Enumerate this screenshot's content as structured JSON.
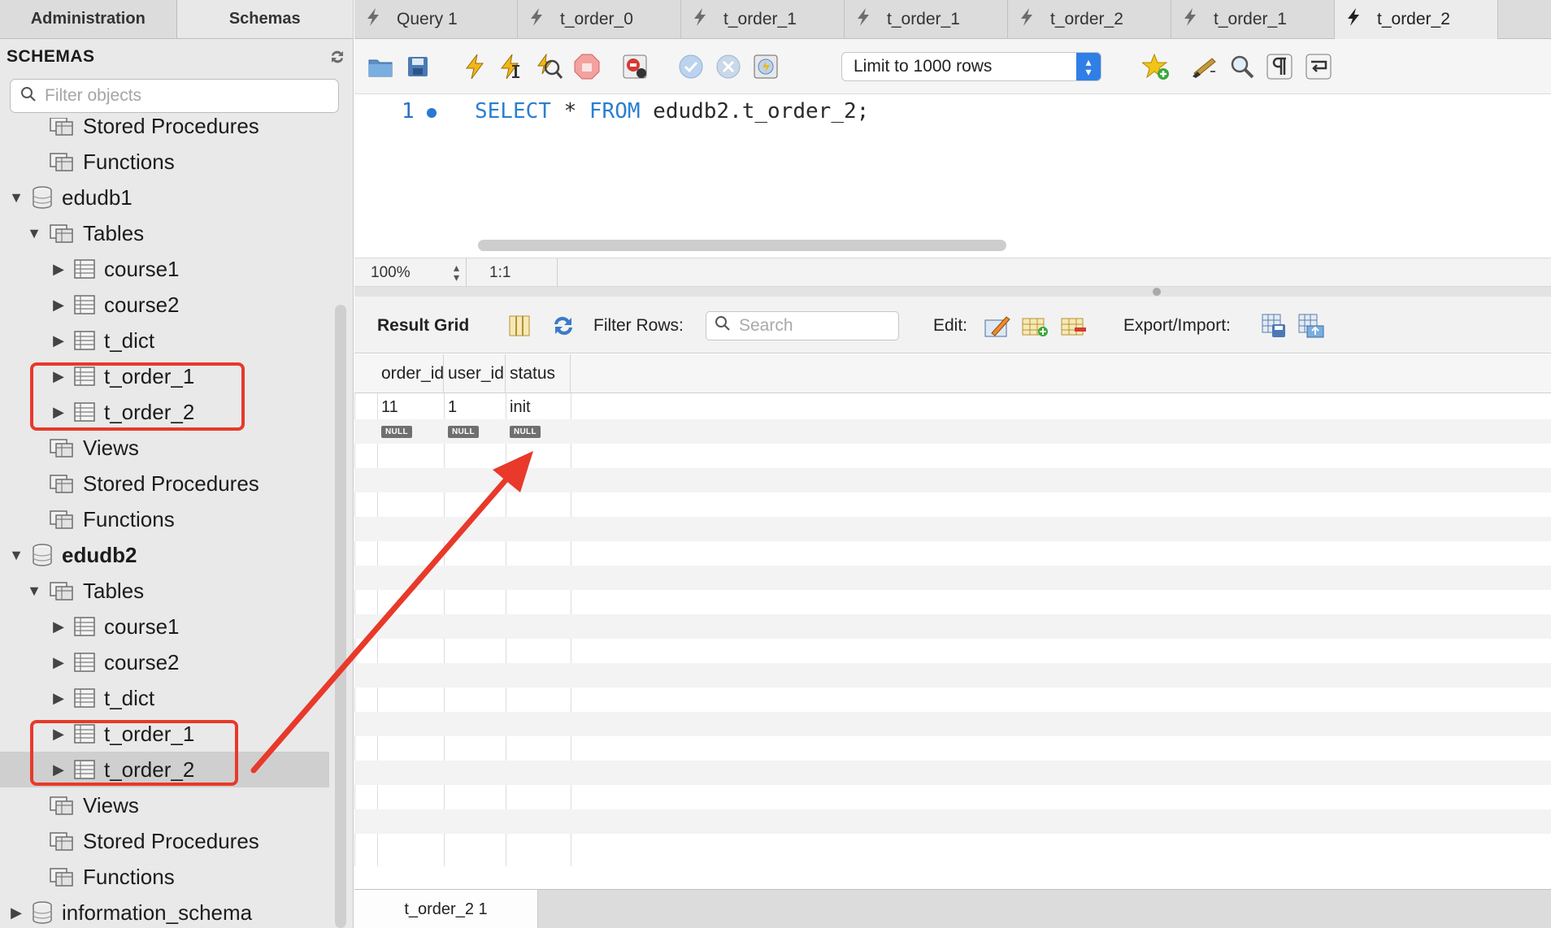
{
  "sidebar": {
    "tabs": [
      "Administration",
      "Schemas"
    ],
    "title": "SCHEMAS",
    "filter_placeholder": "Filter objects",
    "tree": [
      {
        "label": "Stored Procedures",
        "indent": 1,
        "icon": "folder-icon"
      },
      {
        "label": "Functions",
        "indent": 1,
        "icon": "folder-icon"
      },
      {
        "label": "edudb1",
        "indent": 0,
        "icon": "database-icon",
        "expanded": true
      },
      {
        "label": "Tables",
        "indent": 1,
        "icon": "folder-icon",
        "expanded": true
      },
      {
        "label": "course1",
        "indent": 2,
        "icon": "table-icon"
      },
      {
        "label": "course2",
        "indent": 2,
        "icon": "table-icon"
      },
      {
        "label": "t_dict",
        "indent": 2,
        "icon": "table-icon"
      },
      {
        "label": "t_order_1",
        "indent": 2,
        "icon": "table-icon"
      },
      {
        "label": "t_order_2",
        "indent": 2,
        "icon": "table-icon"
      },
      {
        "label": "Views",
        "indent": 1,
        "icon": "folder-icon"
      },
      {
        "label": "Stored Procedures",
        "indent": 1,
        "icon": "folder-icon"
      },
      {
        "label": "Functions",
        "indent": 1,
        "icon": "folder-icon"
      },
      {
        "label": "edudb2",
        "indent": 0,
        "icon": "database-icon",
        "expanded": true,
        "bold": true
      },
      {
        "label": "Tables",
        "indent": 1,
        "icon": "folder-icon",
        "expanded": true
      },
      {
        "label": "course1",
        "indent": 2,
        "icon": "table-icon"
      },
      {
        "label": "course2",
        "indent": 2,
        "icon": "table-icon"
      },
      {
        "label": "t_dict",
        "indent": 2,
        "icon": "table-icon"
      },
      {
        "label": "t_order_1",
        "indent": 2,
        "icon": "table-icon"
      },
      {
        "label": "t_order_2",
        "indent": 2,
        "icon": "table-icon",
        "selected": true
      },
      {
        "label": "Views",
        "indent": 1,
        "icon": "folder-icon"
      },
      {
        "label": "Stored Procedures",
        "indent": 1,
        "icon": "folder-icon"
      },
      {
        "label": "Functions",
        "indent": 1,
        "icon": "folder-icon"
      },
      {
        "label": "information_schema",
        "indent": 0,
        "icon": "database-icon",
        "expanded": false
      }
    ]
  },
  "tabs": [
    {
      "label": "Query 1",
      "active": false
    },
    {
      "label": "t_order_0",
      "active": false
    },
    {
      "label": "t_order_1",
      "active": false
    },
    {
      "label": "t_order_1",
      "active": false
    },
    {
      "label": "t_order_2",
      "active": false
    },
    {
      "label": "t_order_1",
      "active": false
    },
    {
      "label": "t_order_2",
      "active": true
    }
  ],
  "toolbar": {
    "limit_label": "Limit to 1000 rows"
  },
  "editor": {
    "line_number": "1",
    "code_kw1": "SELECT",
    "code_mid": " * ",
    "code_kw2": "FROM",
    "code_rest": " edudb2.t_order_2;"
  },
  "status": {
    "zoom": "100%",
    "position": "1:1"
  },
  "result_bar": {
    "title": "Result Grid",
    "filter_label": "Filter Rows:",
    "search_placeholder": "Search",
    "edit_label": "Edit:",
    "export_label": "Export/Import:"
  },
  "grid": {
    "columns": [
      "order_id",
      "user_id",
      "status"
    ],
    "rows": [
      [
        "11",
        "1",
        "init"
      ],
      [
        "NULL",
        "NULL",
        "NULL"
      ]
    ]
  },
  "bottom": {
    "result_tab": "t_order_2 1"
  },
  "colors": {
    "highlight": "#e8392a",
    "keyword": "#2b7fd0",
    "accent": "#2f7fe6"
  }
}
